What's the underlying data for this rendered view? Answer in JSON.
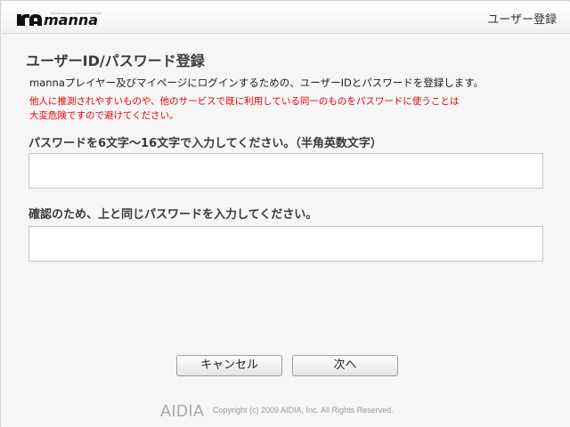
{
  "header": {
    "logo_text": "manna",
    "logo_tagline": "Karaoke Play for Internet Environment",
    "title": "ユーザー登録"
  },
  "main": {
    "page_title": "ユーザーID/パスワード登録",
    "intro": "mannaプレイヤー及びマイページにログインするための、ユーザーIDとパスワードを登録します。",
    "warning_line1": "他人に推測されやすいものや、他のサービスで既に利用している同一のものをパスワードに使うことは",
    "warning_line2": "大変危険ですので避けてください。",
    "password_label": "パスワードを6文字〜16文字で入力してください。（半角英数文字）",
    "password_value": "",
    "confirm_label": "確認のため、上と同じパスワードを入力してください。",
    "confirm_value": ""
  },
  "buttons": {
    "cancel_label": "キャンセル",
    "next_label": "次へ"
  },
  "footer": {
    "brand": "AIDIA",
    "copyright": "Copyright (c) 2009 AIDIA, Inc. All Rights Reserved."
  },
  "colors": {
    "warning": "#e60000",
    "background": "#f6f6f6",
    "title_text": "#3c3c3c"
  }
}
